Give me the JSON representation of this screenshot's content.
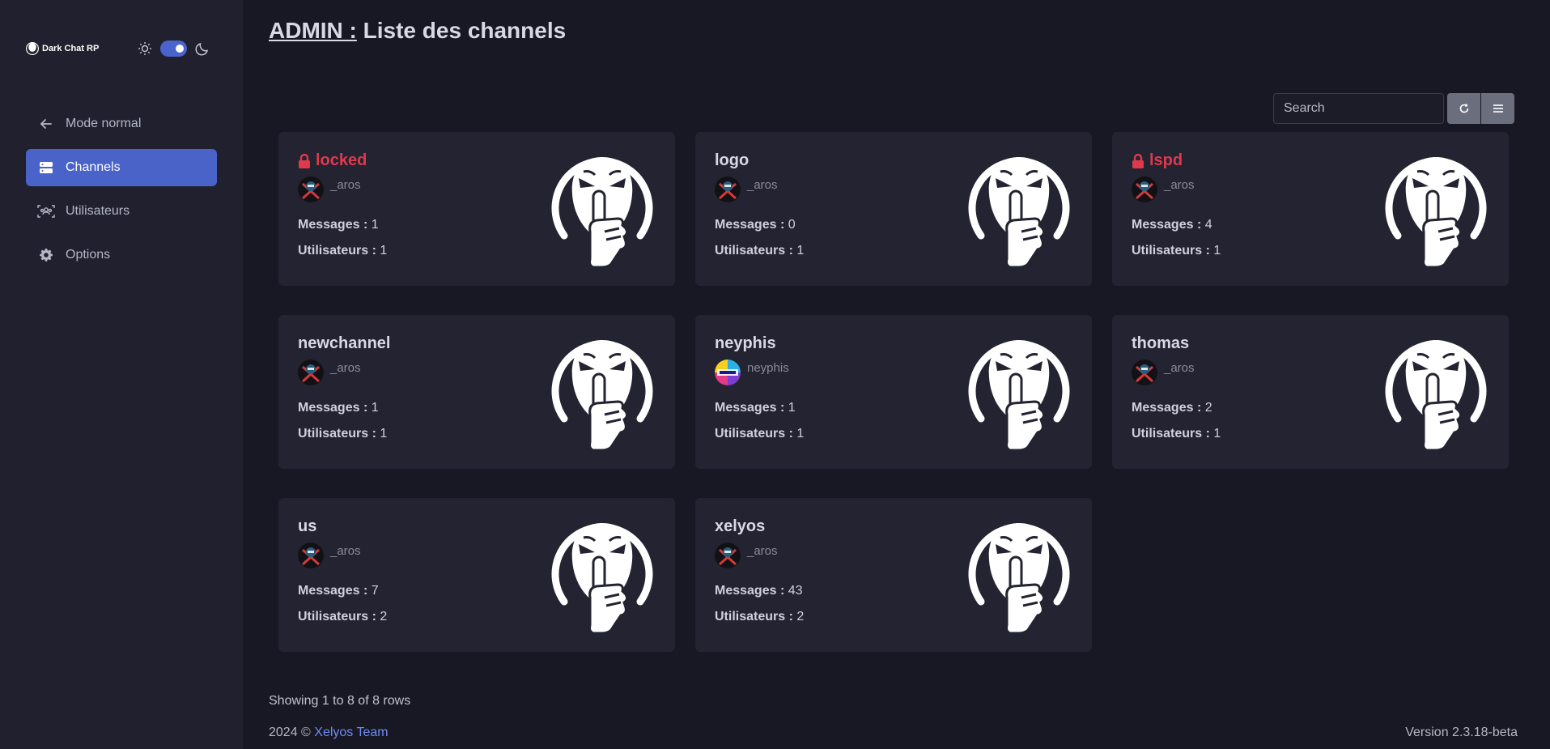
{
  "app": {
    "brand": "Dark Chat RP"
  },
  "header": {
    "admin_label": "ADMIN :",
    "title": " Liste des channels"
  },
  "sidebar": {
    "items": [
      {
        "label": "Mode normal",
        "icon": "arrow-left-icon",
        "active": false
      },
      {
        "label": "Channels",
        "icon": "server-icon",
        "active": true
      },
      {
        "label": "Utilisateurs",
        "icon": "users-icon",
        "active": false
      },
      {
        "label": "Options",
        "icon": "gear-icon",
        "active": false
      }
    ]
  },
  "toolbar": {
    "search_placeholder": "Search"
  },
  "labels": {
    "messages": "Messages :",
    "users": "Utilisateurs :"
  },
  "channels": [
    {
      "name": "locked",
      "locked": true,
      "owner": "_aros",
      "avatar": "aros-avatar",
      "messages": "1",
      "users": "1"
    },
    {
      "name": "logo",
      "locked": false,
      "owner": "_aros",
      "avatar": "aros-avatar",
      "messages": "0",
      "users": "1"
    },
    {
      "name": "lspd",
      "locked": true,
      "owner": "_aros",
      "avatar": "aros-avatar",
      "messages": "4",
      "users": "1"
    },
    {
      "name": "newchannel",
      "locked": false,
      "owner": "_aros",
      "avatar": "aros-avatar",
      "messages": "1",
      "users": "1"
    },
    {
      "name": "neyphis",
      "locked": false,
      "owner": "neyphis",
      "avatar": "neyphis-avatar",
      "messages": "1",
      "users": "1"
    },
    {
      "name": "thomas",
      "locked": false,
      "owner": "_aros",
      "avatar": "aros-avatar",
      "messages": "2",
      "users": "1"
    },
    {
      "name": "us",
      "locked": false,
      "owner": "_aros",
      "avatar": "aros-avatar",
      "messages": "7",
      "users": "2"
    },
    {
      "name": "xelyos",
      "locked": false,
      "owner": "_aros",
      "avatar": "aros-avatar",
      "messages": "43",
      "users": "2"
    }
  ],
  "footer": {
    "rows_info": "Showing 1 to 8 of 8 rows",
    "copyright": "2024 © ",
    "team": "Xelyos Team",
    "version": "Version 2.3.18-beta"
  },
  "colors": {
    "accent": "#4a63c8",
    "locked": "#e0394b",
    "card": "#232331",
    "background": "#181824"
  }
}
